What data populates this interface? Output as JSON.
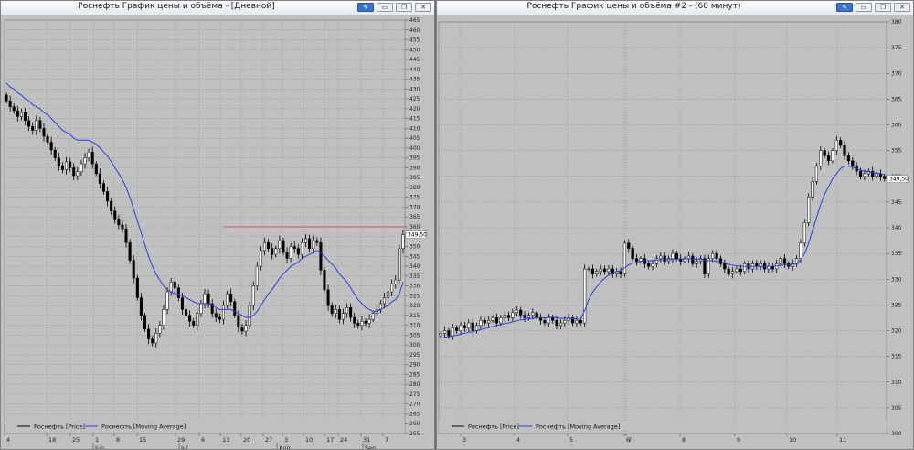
{
  "windows": [
    {
      "title": "Роснефть График цены и объёма - [Дневной]",
      "legend": [
        {
          "name": "Роснефть [Price]",
          "color": "#000000"
        },
        {
          "name": "Роснефть [Moving Average]",
          "color": "#2b3fd6"
        }
      ],
      "price_tag": "349,50"
    },
    {
      "title": "Роснефть График цены и объёма #2 - (60 минут)",
      "legend": [
        {
          "name": "Роснефть [Price]",
          "color": "#000000"
        },
        {
          "name": "Роснефть [Moving Average]",
          "color": "#2b3fd6"
        }
      ],
      "price_tag": "349,50"
    }
  ],
  "title_buttons": {
    "pin": "✎",
    "min": "▭",
    "restore": "❐",
    "close": "✕"
  },
  "chart_data": [
    {
      "type": "candlestick",
      "title": "Роснефть График цены и объёма - [Дневной]",
      "ylim": [
        255,
        465
      ],
      "ytick_step": 5,
      "grid": true,
      "legend_position": "bottom-left",
      "x_day_labels": [
        "4",
        "18",
        "25",
        "1",
        "8",
        "15",
        "29",
        "6",
        "13",
        "20",
        "27",
        "3",
        "10",
        "17",
        "24",
        "31",
        "7"
      ],
      "x_month_labels": [
        "Jun",
        "Jul",
        "Aug",
        "Sep"
      ],
      "close": [
        424,
        421,
        419,
        416,
        418,
        414,
        411,
        409,
        414,
        410,
        406,
        403,
        399,
        395,
        391,
        389,
        393,
        390,
        386,
        388,
        392,
        395,
        398,
        392,
        387,
        382,
        378,
        373,
        368,
        364,
        361,
        359,
        352,
        343,
        334,
        324,
        315,
        308,
        303,
        301,
        306,
        310,
        318,
        327,
        332,
        329,
        324,
        318,
        315,
        312,
        310,
        316,
        321,
        326,
        321,
        316,
        314,
        313,
        320,
        326,
        322,
        315,
        309,
        307,
        310,
        320,
        330,
        340,
        348,
        352,
        349,
        346,
        349,
        353,
        347,
        344,
        350,
        349,
        346,
        352,
        354,
        349,
        353,
        352,
        338,
        328,
        320,
        316,
        318,
        313,
        316,
        319,
        314,
        311,
        310,
        312,
        311,
        313,
        316,
        318,
        321,
        324,
        327,
        331,
        333,
        349,
        356
      ],
      "ma_close": [
        433,
        431,
        430,
        428,
        427,
        425,
        424,
        422,
        421,
        420,
        418,
        417,
        415,
        413,
        411,
        409,
        408,
        407,
        405,
        404,
        404,
        404,
        404,
        403,
        402,
        400,
        398,
        396,
        393,
        390,
        387,
        384,
        380,
        375,
        369,
        363,
        357,
        351,
        345,
        340,
        336,
        333,
        330,
        328,
        327,
        326,
        326,
        325,
        324,
        323,
        322,
        321,
        321,
        321,
        321,
        320,
        319,
        318,
        318,
        318,
        318,
        317,
        316,
        315,
        314,
        314,
        315,
        317,
        320,
        323,
        326,
        328,
        331,
        334,
        336,
        338,
        340,
        341,
        342,
        344,
        345,
        346,
        347,
        348,
        347,
        345,
        343,
        341,
        339,
        336,
        334,
        332,
        329,
        326,
        323,
        321,
        319,
        318,
        317,
        317,
        318,
        319,
        320,
        322,
        323,
        326,
        332
      ],
      "resistance_level": 360
    },
    {
      "type": "candlestick",
      "title": "Роснефть График цены и объёма #2 - (60 минут)",
      "ylim": [
        300,
        380
      ],
      "ytick_step": 5,
      "grid": true,
      "legend_position": "bottom-left",
      "x_day_labels": [
        "3",
        "4",
        "5",
        "6",
        "7",
        "8",
        "9",
        "10",
        "11"
      ],
      "close": [
        319.5,
        320,
        319,
        320.5,
        320,
        321,
        320.5,
        321.5,
        320,
        321,
        322,
        321.5,
        322,
        322.5,
        321.5,
        322.5,
        323,
        322.5,
        323.5,
        324,
        323,
        322.5,
        323,
        323.5,
        322.5,
        322,
        321.5,
        322.5,
        322,
        321,
        321.5,
        322,
        322.5,
        321.5,
        322,
        321.5,
        332,
        332,
        331,
        331.5,
        332,
        331.5,
        332,
        331,
        331.5,
        331,
        337,
        336,
        334,
        333.5,
        334,
        333,
        332.5,
        333,
        334,
        334.5,
        333.5,
        334,
        335,
        334,
        333.5,
        334,
        334.5,
        333,
        333.5,
        334,
        331,
        334,
        335,
        334,
        333,
        332,
        331,
        331.5,
        332,
        331.5,
        333,
        332,
        333,
        332.5,
        333,
        332,
        332.5,
        332,
        333,
        334,
        333,
        332.5,
        333,
        334,
        337,
        341,
        346,
        349,
        352,
        355,
        354,
        353,
        355,
        357,
        356,
        354,
        353,
        352,
        351,
        350,
        350.5,
        351,
        350,
        350.5,
        350,
        349.5
      ],
      "ma_close": [
        318.5,
        318.7,
        318.8,
        319,
        319.1,
        319.3,
        319.5,
        319.7,
        319.8,
        320,
        320.2,
        320.4,
        320.6,
        320.8,
        321,
        321.2,
        321.4,
        321.5,
        321.7,
        321.9,
        322.1,
        322.2,
        322.3,
        322.4,
        322.5,
        322.5,
        322.5,
        322.6,
        322.6,
        322.5,
        322.4,
        322.4,
        322.4,
        322.3,
        322.3,
        322.2,
        324,
        326,
        327.5,
        328.5,
        329.5,
        330.2,
        330.8,
        331.2,
        331.5,
        331.7,
        332.2,
        332.8,
        333.1,
        333.3,
        333.5,
        333.6,
        333.6,
        333.6,
        333.7,
        333.8,
        333.8,
        333.8,
        333.9,
        333.9,
        333.9,
        333.9,
        334,
        333.9,
        333.9,
        333.9,
        333.6,
        333.6,
        333.6,
        333.5,
        333.4,
        333.2,
        332.9,
        332.7,
        332.6,
        332.5,
        332.5,
        332.5,
        332.5,
        332.5,
        332.5,
        332.5,
        332.5,
        332.5,
        332.6,
        332.7,
        332.8,
        332.8,
        332.9,
        333.1,
        333.8,
        335,
        337,
        339.5,
        342,
        344.5,
        346.5,
        348,
        349.5,
        350.5,
        351.5,
        352,
        352,
        351.8,
        351.5,
        351.2,
        351,
        350.9,
        350.7,
        350.6,
        350.5,
        350.3
      ]
    }
  ]
}
